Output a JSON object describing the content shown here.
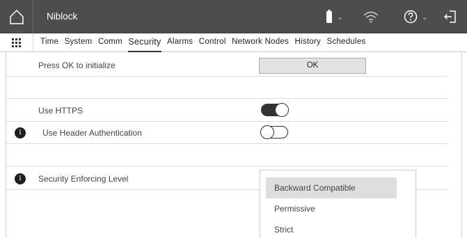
{
  "header": {
    "app_title": "Niblock"
  },
  "tabs": [
    {
      "label": "Time",
      "active": false
    },
    {
      "label": "System",
      "active": false
    },
    {
      "label": "Comm",
      "active": false
    },
    {
      "label": "Security",
      "active": true
    },
    {
      "label": "Alarms",
      "active": false
    },
    {
      "label": "Control",
      "active": false
    },
    {
      "label": "Network Nodes",
      "active": false
    },
    {
      "label": "History",
      "active": false
    },
    {
      "label": "Schedules",
      "active": false
    }
  ],
  "rows": {
    "initialize": {
      "label": "Press OK to initialize",
      "button": "OK"
    },
    "https": {
      "label": "Use HTTPS",
      "value": "on"
    },
    "header_auth": {
      "label": "Use Header Authentication",
      "value": "off"
    },
    "enforcing": {
      "label": "Security Enforcing Level"
    }
  },
  "dropdown": {
    "options": [
      "Backward Compatible",
      "Permissive",
      "Strict"
    ],
    "selected": "Backward Compatible"
  },
  "info_glyph": "i",
  "colors": {
    "topbar": "#4d4d4d",
    "toggle_on": "#333333",
    "button_bg": "#e3e3e3",
    "selected_option": "#dedede"
  },
  "icons": [
    "home-icon",
    "battery-icon",
    "wifi-icon",
    "help-icon",
    "logout-icon",
    "grid-menu-icon",
    "info-icon"
  ]
}
